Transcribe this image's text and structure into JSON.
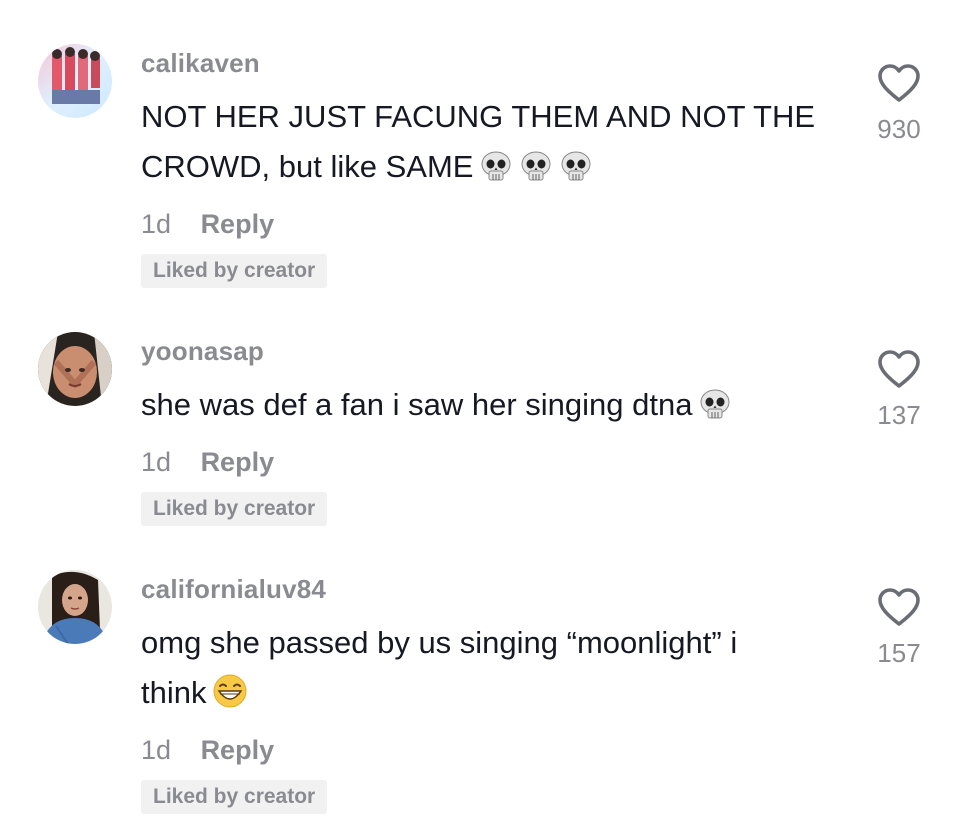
{
  "comments": [
    {
      "username": "calikaven",
      "text": "NOT HER JUST FACUNG THEM AND NOT THE CROWD, but like SAME",
      "emoji": [
        "skull-emoji",
        "skull-emoji",
        "skull-emoji"
      ],
      "age": "1d",
      "reply_label": "Reply",
      "badge": "Liked by creator",
      "like_count": "930"
    },
    {
      "username": "yoonasap",
      "text": "she was def a fan i saw her singing dtna",
      "emoji": [
        "skull-emoji"
      ],
      "age": "1d",
      "reply_label": "Reply",
      "badge": "Liked by creator",
      "like_count": "137"
    },
    {
      "username": "californialuv84",
      "text": "omg she passed by us singing “moonlight” i think",
      "emoji": [
        "grinning-smiling-eyes-emoji"
      ],
      "age": "1d",
      "reply_label": "Reply",
      "badge": "Liked by creator",
      "like_count": "157"
    }
  ],
  "icons": {
    "like": "heart-outline-icon"
  },
  "colors": {
    "username": "#8a8b91",
    "text": "#161823",
    "badge_bg": "#f1f1f2"
  }
}
